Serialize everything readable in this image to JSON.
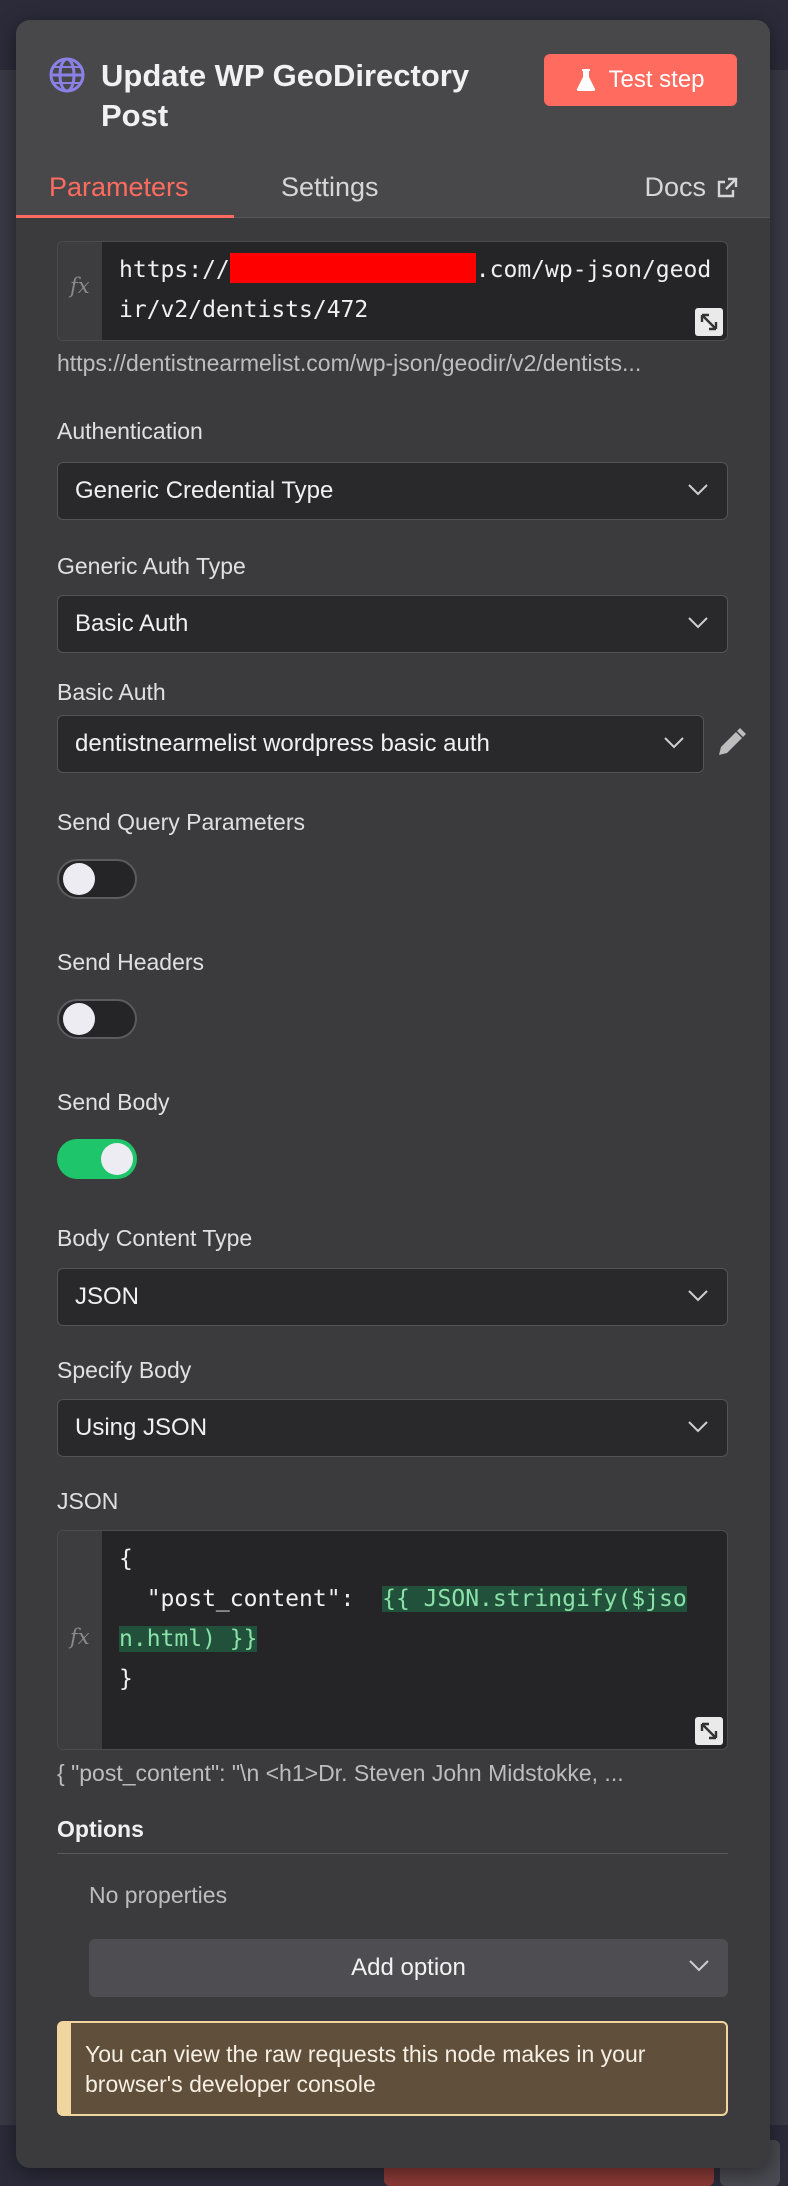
{
  "node": {
    "title": "Update WP GeoDirectory Post",
    "test_button": "Test step"
  },
  "tabs": {
    "parameters": "Parameters",
    "settings": "Settings",
    "docs": "Docs"
  },
  "url": {
    "prefix": "https://",
    "suffix_line1": ".com/wp-json/geod",
    "line2": "ir/v2/dentists/472",
    "preview": "https://dentistnearmelist.com/wp-json/geodir/v2/dentists..."
  },
  "authentication": {
    "label": "Authentication",
    "value": "Generic Credential Type"
  },
  "generic_auth_type": {
    "label": "Generic Auth Type",
    "value": "Basic Auth"
  },
  "basic_auth": {
    "label": "Basic Auth",
    "value": "dentistnearmelist wordpress basic auth"
  },
  "send_query": {
    "label": "Send Query Parameters",
    "enabled": false
  },
  "send_headers": {
    "label": "Send Headers",
    "enabled": false
  },
  "send_body": {
    "label": "Send Body",
    "enabled": true
  },
  "body_content_type": {
    "label": "Body Content Type",
    "value": "JSON"
  },
  "specify_body": {
    "label": "Specify Body",
    "value": "Using JSON"
  },
  "json": {
    "label": "JSON",
    "line1": "{",
    "line2_key": "  \"post_content\":  ",
    "line2_expr": "{{ JSON.stringify($jso",
    "line3_expr": "n.html) }}",
    "line4": "}",
    "preview": "{  \"post_content\":  \"\\n  <h1>Dr. Steven John Midstokke, ..."
  },
  "options": {
    "title": "Options",
    "empty": "No properties",
    "add_button": "Add option"
  },
  "notice": "You can view the raw requests this node makes in your browser's developer console",
  "colors": {
    "accent": "#ff6b5e",
    "toggle_on": "#1fc56a",
    "panel": "#3b3b3e",
    "notice_bg": "#5f4f3b",
    "notice_border": "#f1d59e"
  }
}
